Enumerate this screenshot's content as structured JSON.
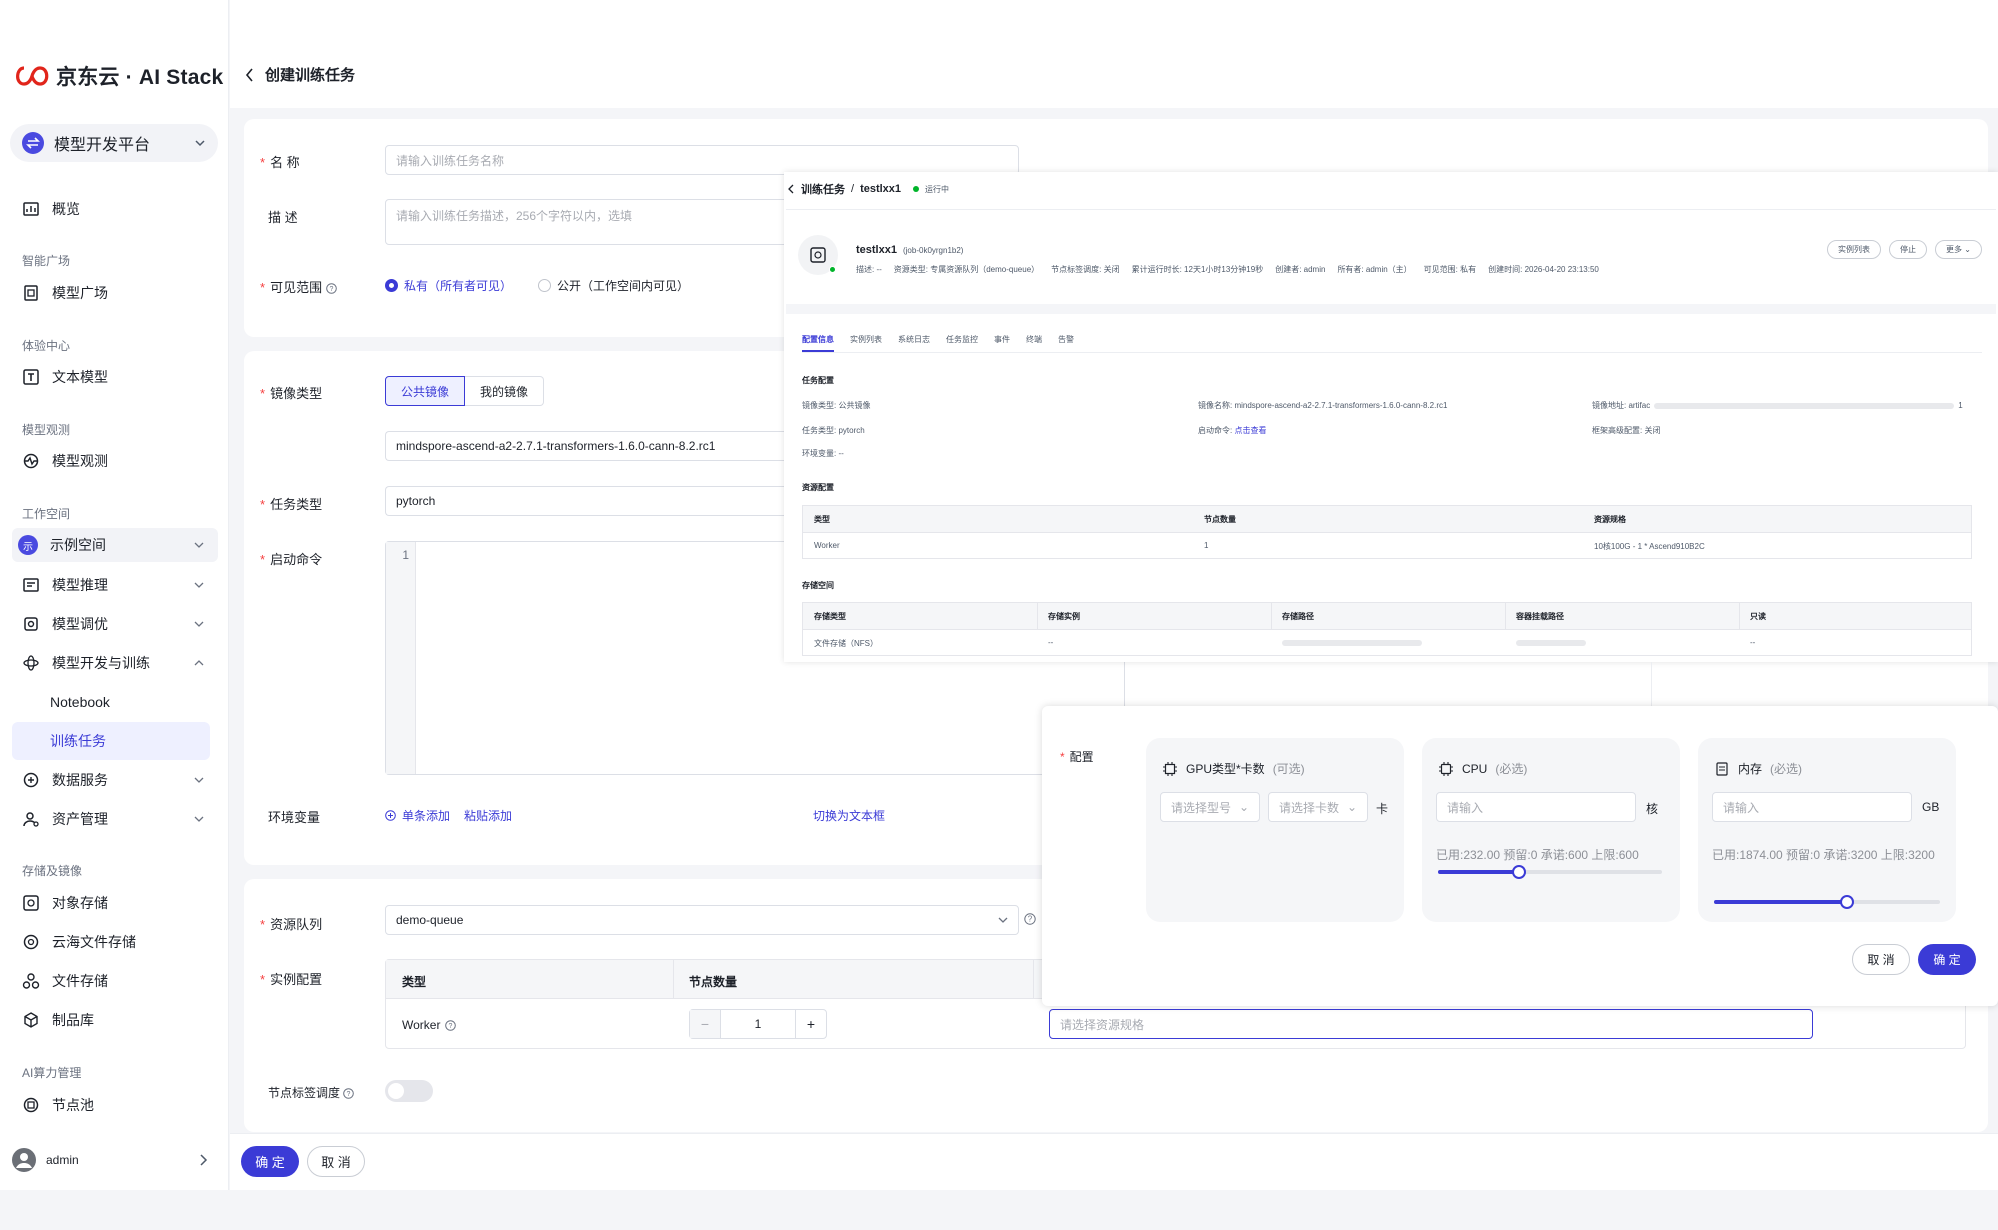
{
  "sidebar": {
    "logo": "京东云 · AI Stack",
    "platform": "模型开发平台",
    "overview": "概览",
    "groups": {
      "intel": "智能广场",
      "exp": "体验中心",
      "obs": "模型观测",
      "ws": "工作空间",
      "storage": "存储及镜像",
      "compute": "AI算力管理"
    },
    "model_square": "模型广场",
    "text_model": "文本模型",
    "model_obs": "模型观测",
    "workspace_badge": "示",
    "workspace": "示例空间",
    "inference": "模型推理",
    "tuning": "模型调优",
    "dev_train": "模型开发与训练",
    "notebook": "Notebook",
    "train_task": "训练任务",
    "data_service": "数据服务",
    "asset_mgmt": "资产管理",
    "object_storage": "对象存储",
    "cloud_fs": "云海文件存储",
    "file_storage": "文件存储",
    "artifact_repo": "制品库",
    "node_pool": "节点池",
    "user": "admin"
  },
  "header": {
    "title": "创建训练任务"
  },
  "form": {
    "name_label": "名 称",
    "name_placeholder": "请输入训练任务名称",
    "desc_label": "描 述",
    "desc_placeholder": "请输入训练任务描述，256个字符以内，选填",
    "visibility_label": "可见范围",
    "visibility_private": "私有（所有者可见）",
    "visibility_public": "公开（工作空间内可见）",
    "image_type_label": "镜像类型",
    "image_public": "公共镜像",
    "image_mine": "我的镜像",
    "image_value": "mindspore-ascend-a2-2.7.1-transformers-1.6.0-cann-8.2.rc1",
    "task_type_label": "任务类型",
    "task_type_value": "pytorch",
    "start_cmd_label": "启动命令",
    "line_no": "1",
    "env_label": "环境变量",
    "env_add_single": "单条添加",
    "env_paste": "粘贴添加",
    "env_switch": "切换为文本框",
    "queue_label": "资源队列",
    "queue_value": "demo-queue",
    "instance_label": "实例配置",
    "col_type": "类型",
    "col_nodes": "节点数量",
    "worker": "Worker",
    "node_count": "1",
    "spec_placeholder": "请选择资源规格",
    "node_label_sched": "节点标签调度"
  },
  "footer": {
    "confirm": "确 定",
    "cancel": "取 消"
  },
  "detail": {
    "breadcrumb_root": "训练任务",
    "breadcrumb_sep": "/",
    "breadcrumb_current": "testlxx1",
    "status": "运行中",
    "job_name": "testlxx1",
    "job_id": "(job-0k0yrgn1b2)",
    "meta": {
      "desc": "描述: --",
      "resource": "资源类型: 专属资源队列（demo-queue）",
      "node_sched": "节点标签调度: 关闭",
      "runtime": "累计运行时长: 12天1小时13分钟19秒",
      "creator": "创建者: admin",
      "owner": "所有者: admin（主）",
      "visibility": "可见范围: 私有",
      "created": "创建时间: 2026-04-20 23:13:50"
    },
    "btn_instances": "实例列表",
    "btn_stop": "停止",
    "btn_more": "更多",
    "tabs": [
      "配置信息",
      "实例列表",
      "系统日志",
      "任务监控",
      "事件",
      "终端",
      "告警"
    ],
    "task_config_title": "任务配置",
    "image_type": "镜像类型: 公共镜像",
    "image_name": "镜像名称: mindspore-ascend-a2-2.7.1-transformers-1.6.0-cann-8.2.rc1",
    "image_addr": "镜像地址: artifac",
    "image_addr_tail": "1",
    "task_type": "任务类型: pytorch",
    "start_cmd_label": "启动命令:",
    "start_cmd_link": "点击查看",
    "framework": "框架高级配置: 关闭",
    "env": "环境变量: --",
    "resource_title": "资源配置",
    "res_cols": [
      "类型",
      "节点数量",
      "资源规格"
    ],
    "res_row": [
      "Worker",
      "1",
      "10核100G - 1 * Ascend910B2C"
    ],
    "storage_title": "存储空间",
    "sto_cols": [
      "存储类型",
      "存储实例",
      "存储路径",
      "容器挂载路径",
      "只读"
    ],
    "sto_row": [
      "文件存储（NFS）",
      "--",
      "",
      "",
      "--"
    ]
  },
  "config": {
    "label": "配置",
    "gpu_title": "GPU类型*卡数",
    "gpu_hint": "(可选)",
    "gpu_model_ph": "请选择型号",
    "gpu_count_ph": "请选择卡数",
    "gpu_unit": "卡",
    "cpu_title": "CPU",
    "cpu_hint": "(必选)",
    "cpu_ph": "请输入",
    "cpu_unit": "核",
    "cpu_stats": "已用:232.00  预留:0  承诺:600  上限:600",
    "cpu_level": 0.36,
    "mem_title": "内存",
    "mem_hint": "(必选)",
    "mem_ph": "请输入",
    "mem_unit": "GB",
    "mem_stats": "已用:1874.00  预留:0  承诺:3200  上限:3200",
    "mem_level": 0.59,
    "cancel": "取 消",
    "confirm": "确 定"
  }
}
